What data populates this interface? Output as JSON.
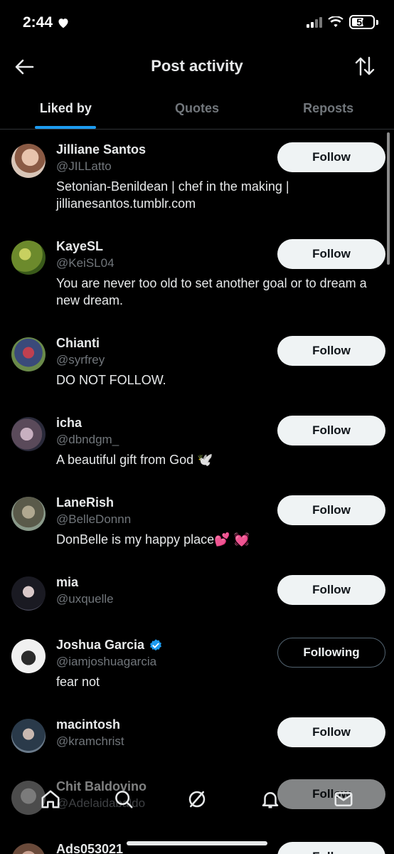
{
  "status_bar": {
    "time": "2:44",
    "battery": "50"
  },
  "header": {
    "title": "Post activity"
  },
  "tabs": [
    {
      "label": "Liked by",
      "active": true
    },
    {
      "label": "Quotes",
      "active": false
    },
    {
      "label": "Reposts",
      "active": false
    }
  ],
  "users": [
    {
      "name": "Jilliane Santos",
      "handle": "@JILLatto",
      "bio": "Setonian-Benildean | chef in the making | jillianesantos.tumblr.com",
      "button": "Follow",
      "avatar_color": "#c9a08a"
    },
    {
      "name": "KayeSL",
      "handle": "@KeiSL04",
      "bio": "You are never too old to set another goal or to dream a new dream.",
      "button": "Follow",
      "avatar_color": "#7a9a3a"
    },
    {
      "name": "Chianti",
      "handle": "@syrfrey",
      "bio": "DO NOT FOLLOW.",
      "button": "Follow",
      "avatar_color": "#8a3a4a"
    },
    {
      "name": "icha",
      "handle": "@dbndgm_",
      "bio": "A beautiful gift from God 🕊️",
      "button": "Follow",
      "avatar_color": "#6a5a6a"
    },
    {
      "name": "LaneRish",
      "handle": "@BelleDonnn",
      "bio": "DonBelle is my happy place💕 💓",
      "button": "Follow",
      "avatar_color": "#7a7a6a"
    },
    {
      "name": "mia",
      "handle": "@uxquelle",
      "bio": "",
      "button": "Follow",
      "avatar_color": "#3a3a44"
    },
    {
      "name": "Joshua Garcia",
      "handle": "@iamjoshuagarcia",
      "bio": "fear not",
      "button": "Following",
      "verified": true,
      "avatar_color": "#d8d8d8"
    },
    {
      "name": "macintosh",
      "handle": "@kramchrist",
      "bio": "",
      "button": "Follow",
      "avatar_color": "#4a5a6a"
    },
    {
      "name": "Chit Baldovino",
      "handle": "@Adelaidabaldo",
      "bio": "",
      "button": "Follow",
      "avatar_color": "#9a9a9a"
    },
    {
      "name": "Ads053021",
      "handle": "",
      "bio": "",
      "button": "Follow",
      "avatar_color": "#8a6a5a"
    }
  ],
  "bottom_nav": [
    "home-icon",
    "search-icon",
    "grok-icon",
    "notifications-icon",
    "messages-icon"
  ],
  "colors": {
    "accent": "#1d9bf0",
    "background": "#000000",
    "muted": "#71767b"
  }
}
